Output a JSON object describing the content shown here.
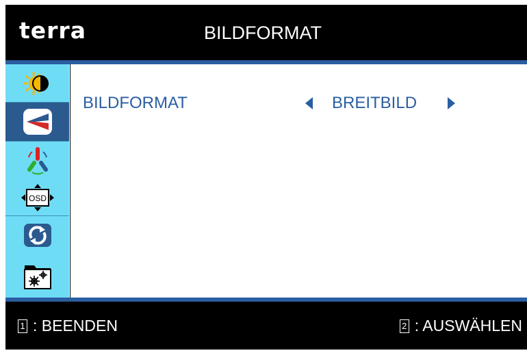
{
  "header": {
    "brand": "terra",
    "title": "BILDFORMAT"
  },
  "menu": {
    "items": [
      {
        "icon": "brightness-contrast-icon"
      },
      {
        "icon": "picture-format-icon",
        "active": true
      },
      {
        "icon": "color-rgb-icon"
      },
      {
        "icon": "osd-settings-icon"
      },
      {
        "icon": "reset-icon"
      },
      {
        "icon": "extra-settings-icon"
      }
    ]
  },
  "setting": {
    "label": "BILDFORMAT",
    "value": "BREITBILD"
  },
  "footer": {
    "exit_key": "1",
    "exit_label": ": BEENDEN",
    "select_key": "2",
    "select_label": ": AUSWÄHLEN"
  },
  "colors": {
    "accent": "#2a5ea0",
    "sidebar": "#6fdcf6",
    "active": "#2b5a8f",
    "background": "#000000"
  }
}
